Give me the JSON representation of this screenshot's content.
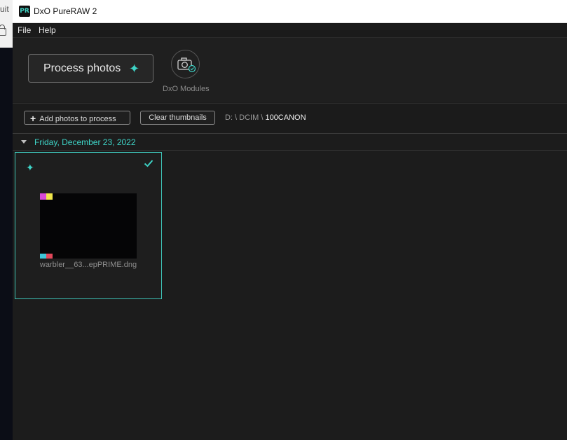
{
  "window": {
    "title": "DxO PureRAW 2",
    "app_icon": "PR"
  },
  "background": {
    "fragment_text": "uit"
  },
  "menu": {
    "items": [
      "File",
      "Help"
    ]
  },
  "toolbar": {
    "process_label": "Process photos",
    "process_icon": "sparkle-icon",
    "modules_label": "DxO Modules",
    "modules_icon": "camera-check-icon"
  },
  "actions": {
    "add_label": "Add photos to process",
    "clear_label": "Clear thumbnails",
    "path_prefix": "D: \\ DCIM \\",
    "path_current": "100CANON"
  },
  "group": {
    "date": "Friday, December 23, 2022"
  },
  "photos": [
    {
      "filename": "warbler__63...epPRIME.dng",
      "selected": true,
      "processed": true
    }
  ],
  "colors": {
    "accent": "#3ed3c6",
    "swatches_top": [
      "#d84ad8",
      "#f0e64a"
    ],
    "swatches_bottom": [
      "#3fc6d8",
      "#e2475a"
    ]
  }
}
